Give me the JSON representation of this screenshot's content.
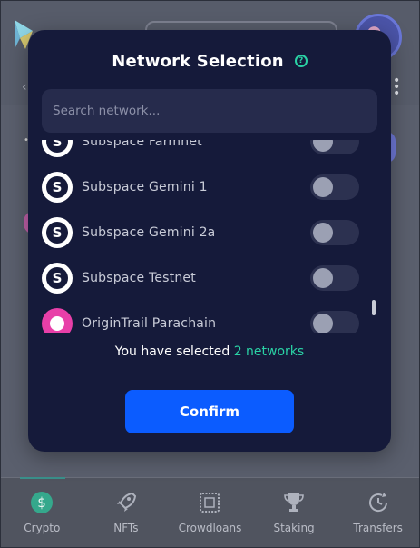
{
  "modal": {
    "title": "Network Selection",
    "help_icon": "question-circle-icon",
    "search": {
      "placeholder": "Search network...",
      "value": ""
    },
    "networks": [
      {
        "name": "Subspace Farmnet",
        "logo": "subspace-logo",
        "selected": false
      },
      {
        "name": "Subspace Gemini 1",
        "logo": "subspace-logo",
        "selected": false
      },
      {
        "name": "Subspace Gemini 2a",
        "logo": "subspace-logo",
        "selected": false
      },
      {
        "name": "Subspace Testnet",
        "logo": "subspace-logo",
        "selected": false
      },
      {
        "name": "OriginTrail Parachain",
        "logo": "origintrail-logo",
        "selected": false
      }
    ],
    "selected_prefix": "You have selected ",
    "selected_count_text": "2 networks",
    "confirm_label": "Confirm"
  },
  "bottom_nav": [
    {
      "label": "Crypto",
      "icon": "dollar-coin-icon",
      "active": true
    },
    {
      "label": "NFTs",
      "icon": "rocket-icon",
      "active": false
    },
    {
      "label": "Crowdloans",
      "icon": "stamp-icon",
      "active": false
    },
    {
      "label": "Staking",
      "icon": "trophy-icon",
      "active": false
    },
    {
      "label": "Transfers",
      "icon": "clock-arrow-icon",
      "active": false
    }
  ],
  "colors": {
    "accent": "#2ad2a5",
    "primary_button": "#0b5cff",
    "modal_bg": "#151a3a"
  }
}
